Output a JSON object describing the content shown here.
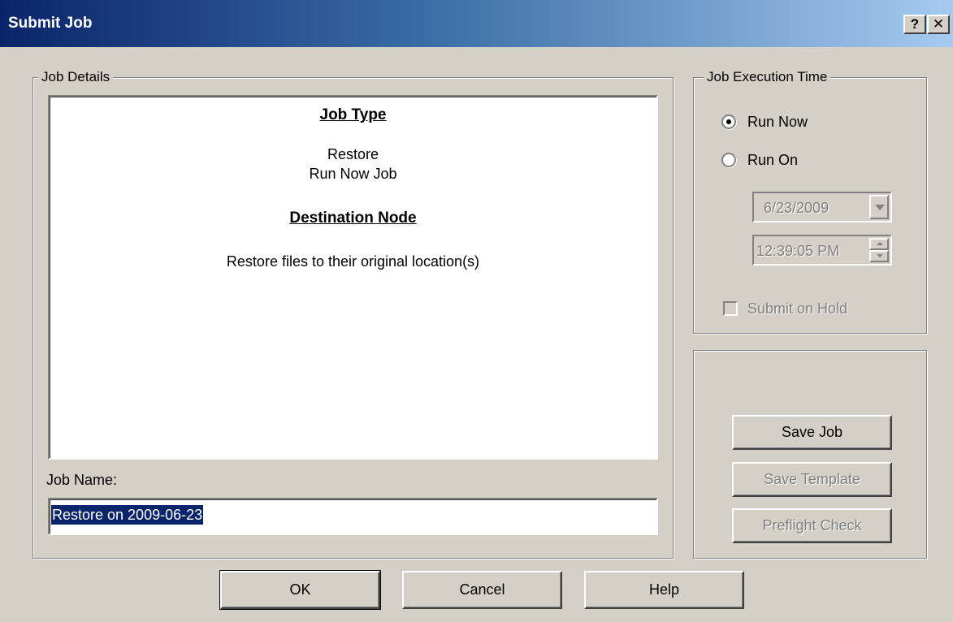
{
  "window": {
    "title": "Submit Job",
    "help_button": "?",
    "close_button": "✕"
  },
  "job_details": {
    "group_title": "Job Details",
    "job_type_heading": "Job Type",
    "job_type_line1": "Restore",
    "job_type_line2": "Run Now Job",
    "destination_heading": "Destination Node",
    "destination_text": "Restore files to their original location(s)",
    "job_name_label": "Job Name:",
    "job_name_value": "Restore on 2009-06-23"
  },
  "execution_time": {
    "group_title": "Job Execution Time",
    "run_now_label": "Run Now",
    "run_on_label": "Run On",
    "selected": "run_now",
    "date_value": "6/23/2009",
    "time_value": "12:39:05 PM",
    "submit_on_hold_label": "Submit on Hold"
  },
  "actions": {
    "save_job": "Save Job",
    "save_template": "Save Template",
    "preflight_check": "Preflight Check"
  },
  "footer": {
    "ok": "OK",
    "cancel": "Cancel",
    "help": "Help"
  }
}
